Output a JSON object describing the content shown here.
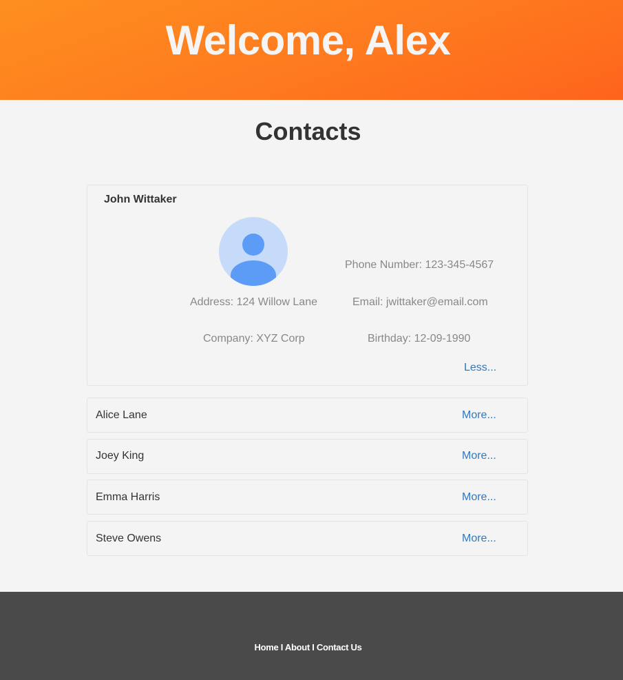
{
  "header": {
    "welcome": "Welcome, Alex"
  },
  "contacts_section": {
    "title": "Contacts"
  },
  "expanded_contact": {
    "name": "John Wittaker",
    "avatar_icon": "user-avatar-icon",
    "phone": "Phone Number: 123-345-4567",
    "address": "Address: 124 Willow Lane",
    "email": "Email: jwittaker@email.com",
    "company": "Company: XYZ Corp",
    "birthday": "Birthday: 12-09-1990",
    "toggle_label": "Less..."
  },
  "contacts": [
    {
      "name": "Alice Lane",
      "toggle_label": "More..."
    },
    {
      "name": "Joey King",
      "toggle_label": "More..."
    },
    {
      "name": "Emma Harris",
      "toggle_label": "More..."
    },
    {
      "name": "Steve Owens",
      "toggle_label": "More..."
    }
  ],
  "footer": {
    "links": [
      "Home",
      "About",
      "Contact Us"
    ],
    "separator": "I"
  },
  "colors": {
    "header_gradient_start": "#fe8f1f",
    "header_gradient_end": "#fe641c",
    "link": "#2f78c0",
    "footer_bg": "#4a4a4a",
    "avatar_fg": "#5c9bf6",
    "avatar_bg": "#c6dafa"
  }
}
